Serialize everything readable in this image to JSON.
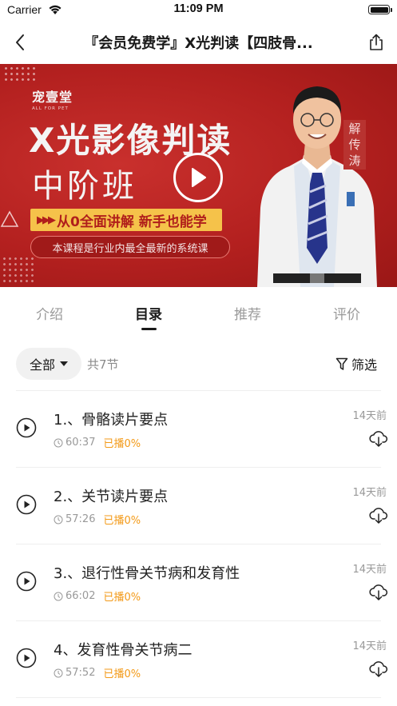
{
  "status_bar": {
    "carrier": "Carrier",
    "time": "11:09 PM"
  },
  "nav": {
    "title": "『会员免费学』X光判读【四肢骨..."
  },
  "banner": {
    "brand_cn": "宠壹堂",
    "brand_en": "ALL FOR PET",
    "headline_1": "X光影像判读",
    "headline_2": "中阶班",
    "tagline": "从0全面讲解 新手也能学",
    "subtitle": "本课程是行业内最全最新的系统课",
    "teacher_name": [
      "解",
      "传",
      "涛"
    ],
    "colors": {
      "background": "#b3201f",
      "tagline_bg": "#f5c24a"
    }
  },
  "tabs": [
    {
      "label": "介绍",
      "active": false
    },
    {
      "label": "目录",
      "active": true
    },
    {
      "label": "推荐",
      "active": false
    },
    {
      "label": "评价",
      "active": false
    }
  ],
  "filter": {
    "all_label": "全部",
    "count": "共7节",
    "filter_label": "筛选"
  },
  "lessons": [
    {
      "title": "1.、骨骼读片要点",
      "duration": "60:37",
      "progress": "已播0%",
      "date": "14天前"
    },
    {
      "title": "2.、关节读片要点",
      "duration": "57:26",
      "progress": "已播0%",
      "date": "14天前"
    },
    {
      "title": "3.、退行性骨关节病和发育性",
      "duration": "66:02",
      "progress": "已播0%",
      "date": "14天前"
    },
    {
      "title": "4、发育性骨关节病二",
      "duration": "57:52",
      "progress": "已播0%",
      "date": "14天前"
    }
  ],
  "colors": {
    "accent_orange": "#f39a18",
    "muted_text": "#999999",
    "active_tab": "#1a1a1a"
  }
}
